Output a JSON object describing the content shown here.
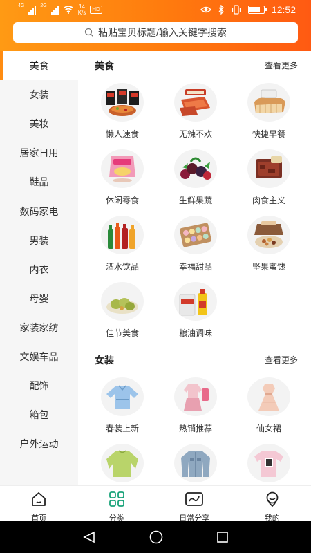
{
  "status_bar": {
    "network_1": "4G",
    "network_2": "2G",
    "speed_value": "14",
    "speed_unit": "K/s",
    "hd": "HD",
    "time": "12:52",
    "battery_level": 0.8
  },
  "search": {
    "placeholder": "粘贴宝贝标题/输入关键字搜索"
  },
  "colors": {
    "accent": "#ff8c12",
    "header_start": "#ff9a14",
    "header_end": "#ff5a12",
    "nav_active": "#1aa37a"
  },
  "sidebar": {
    "items": [
      {
        "label": "美食",
        "active": true
      },
      {
        "label": "女装"
      },
      {
        "label": "美妆"
      },
      {
        "label": "居家日用"
      },
      {
        "label": "鞋品"
      },
      {
        "label": "数码家电"
      },
      {
        "label": "男装"
      },
      {
        "label": "内衣"
      },
      {
        "label": "母婴"
      },
      {
        "label": "家装家纺"
      },
      {
        "label": "文娱车品"
      },
      {
        "label": "配饰"
      },
      {
        "label": "箱包"
      },
      {
        "label": "户外运动"
      }
    ]
  },
  "sections": [
    {
      "title": "美食",
      "more": "查看更多",
      "items": [
        {
          "label": "懒人速食",
          "icon": "instant-noodles-image"
        },
        {
          "label": "无辣不欢",
          "icon": "spicy-snacks-image"
        },
        {
          "label": "快捷早餐",
          "icon": "bread-image"
        },
        {
          "label": "休闲零食",
          "icon": "chips-bag-image"
        },
        {
          "label": "生鲜果蔬",
          "icon": "fruits-image"
        },
        {
          "label": "肉食主义",
          "icon": "meat-jerky-image"
        },
        {
          "label": "酒水饮品",
          "icon": "drinks-bottles-image"
        },
        {
          "label": "幸福甜品",
          "icon": "macarons-image"
        },
        {
          "label": "坚果蜜饯",
          "icon": "nuts-box-image"
        },
        {
          "label": "佳节美食",
          "icon": "dumplings-image"
        },
        {
          "label": "粮油调味",
          "icon": "rice-oil-image"
        }
      ]
    },
    {
      "title": "女装",
      "more": "查看更多",
      "items": [
        {
          "label": "春装上新",
          "icon": "blue-blouse-image"
        },
        {
          "label": "热销推荐",
          "icon": "pink-outfit-image"
        },
        {
          "label": "仙女裙",
          "icon": "pink-dress-image"
        },
        {
          "label": "",
          "icon": "green-sweater-image"
        },
        {
          "label": "",
          "icon": "denim-jacket-image"
        },
        {
          "label": "",
          "icon": "pink-tshirt-image"
        }
      ]
    }
  ],
  "bottom_nav": [
    {
      "label": "首页",
      "icon": "home-icon"
    },
    {
      "label": "分类",
      "icon": "category-grid-icon",
      "active": true
    },
    {
      "label": "日常分享",
      "icon": "share-chart-icon"
    },
    {
      "label": "我的",
      "icon": "profile-icon"
    }
  ]
}
